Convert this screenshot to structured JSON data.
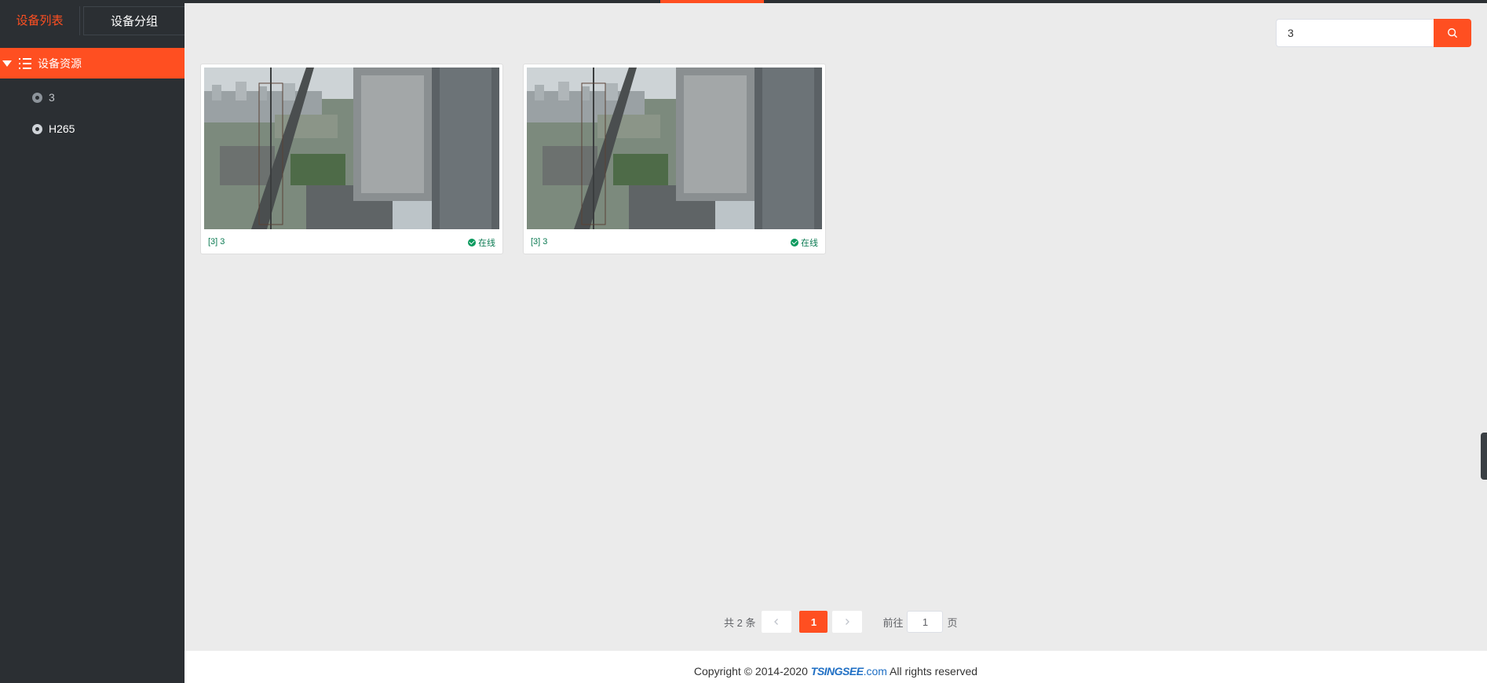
{
  "sidebar": {
    "tabs": [
      {
        "label": "设备列表",
        "active": true
      },
      {
        "label": "设备分组",
        "active": false
      }
    ],
    "tree_root": {
      "label": "设备资源",
      "icon": "list-icon"
    },
    "items": [
      {
        "label": "3",
        "icon": "camera-icon",
        "status": "offline"
      },
      {
        "label": "H265",
        "icon": "camera-icon",
        "status": "online"
      }
    ]
  },
  "search": {
    "value": "3",
    "icon": "search-icon"
  },
  "cards": [
    {
      "name": "[3] 3",
      "status": "在线"
    },
    {
      "name": "[3] 3",
      "status": "在线"
    }
  ],
  "pagination": {
    "total_text": "共 2 条",
    "current_page": "1",
    "goto_prefix": "前往",
    "goto_value": "1",
    "goto_suffix": "页"
  },
  "footer": {
    "prefix": "Copyright © 2014-2020",
    "brand": "TSINGSEE",
    "domain": ".com",
    "suffix": "All rights reserved"
  },
  "colors": {
    "accent": "#ff4f21",
    "sidebar": "#2b2f33",
    "online": "#0b7a52"
  }
}
